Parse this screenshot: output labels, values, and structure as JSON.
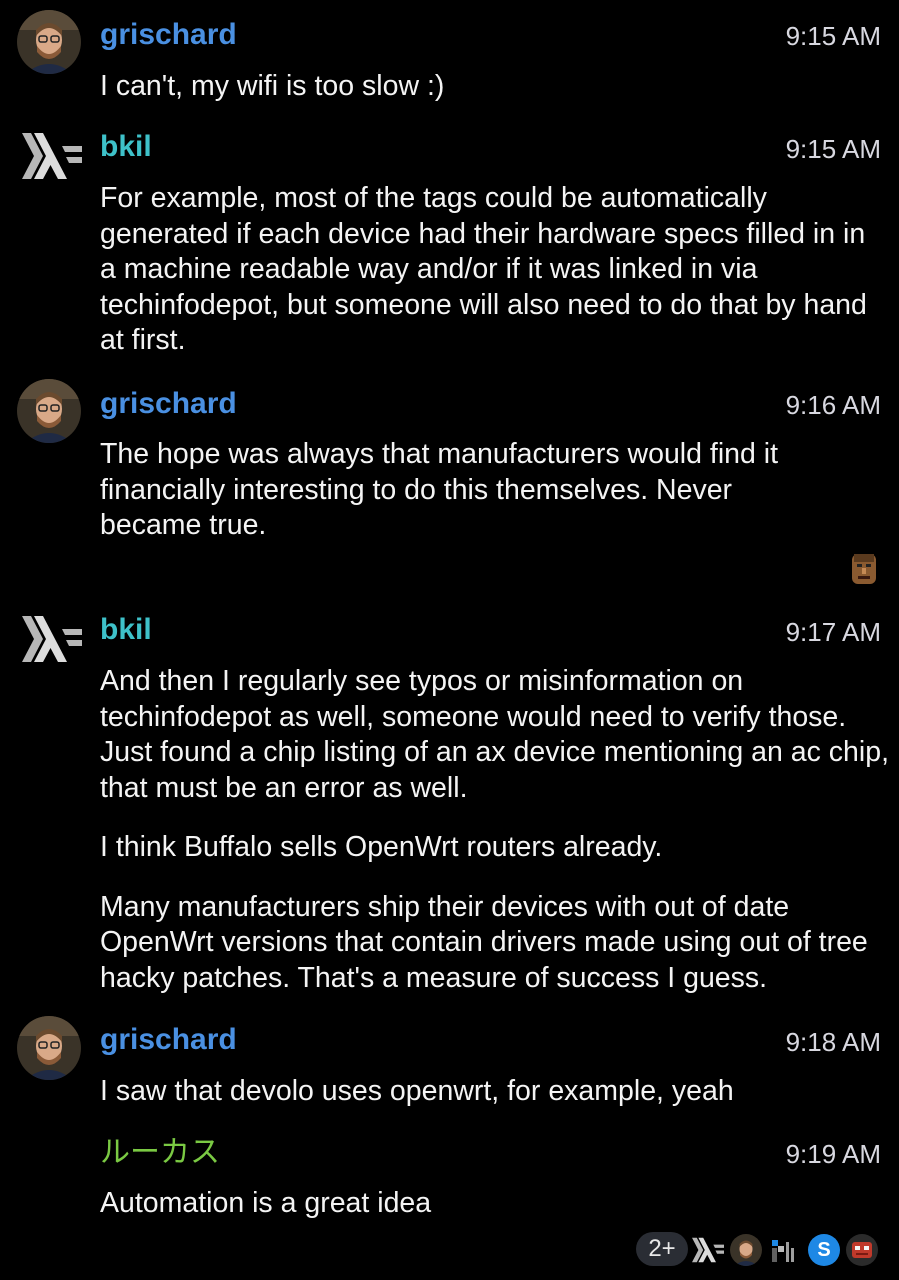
{
  "messages": [
    {
      "sender": "grischard",
      "sender_color": "#4a90e2",
      "avatar": "person-avatar-icon",
      "time": "9:15 AM",
      "paragraphs": [
        "I can't, my wifi is too slow :)"
      ]
    },
    {
      "sender": "bkil",
      "sender_color": "#3ec1c9",
      "avatar": "haskell-logo-icon",
      "time": "9:15 AM",
      "paragraphs": [
        "For example, most of the tags could be automatically generated if each device had their hardware specs filled in in a machine readable way and/or if it was linked in via techinfodepot, but someone will also need to do that by hand at first."
      ]
    },
    {
      "sender": "grischard",
      "sender_color": "#4a90e2",
      "avatar": "person-avatar-icon",
      "time": "9:16 AM",
      "paragraphs": [
        "The hope was always that manufacturers would find it financially interesting to do this themselves. Never became true."
      ]
    },
    {
      "sender": "bkil",
      "sender_color": "#3ec1c9",
      "avatar": "haskell-logo-icon",
      "time": "9:17 AM",
      "paragraphs": [
        "And then I regularly see typos or misinformation on techinfodepot as well, someone would need to verify those. Just found a chip listing of an ax device mentioning an ac chip, that must be an error as well.",
        "I think Buffalo sells OpenWrt routers already.",
        "Many manufacturers ship their devices with out of date OpenWrt versions that contain drivers made using out of tree hacky patches. That's a measure of success I guess."
      ]
    },
    {
      "sender": "grischard",
      "sender_color": "#4a90e2",
      "avatar": "person-avatar-icon",
      "time": "9:18 AM",
      "paragraphs": [
        "I saw that devolo uses openwrt, for example, yeah"
      ]
    },
    {
      "sender": "ルーカス",
      "sender_color": "#7ac943",
      "avatar": "",
      "time": "9:19 AM",
      "paragraphs": [
        "Automation is a great idea"
      ]
    }
  ],
  "read_receipts": {
    "count_label": "2+",
    "avatars": [
      "haskell-logo-icon",
      "person-avatar-icon",
      "flag-icon",
      "S",
      "robot-avatar-icon"
    ]
  }
}
